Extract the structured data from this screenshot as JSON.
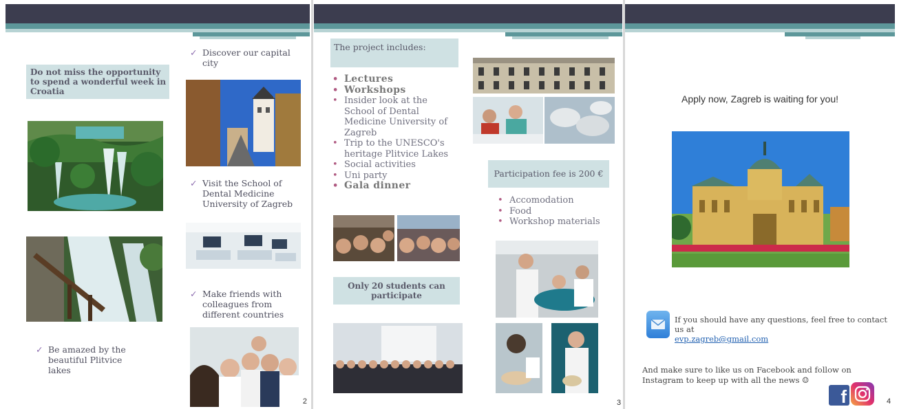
{
  "page2": {
    "opportunity_box": "Do not miss the opportunity to spend a wonderful  week in Croatia",
    "discover": "Discover our capital city",
    "visit": "Visit the School of Dental Medicine University of Zagreb",
    "friends": "Make friends with colleagues from different countries",
    "amazed": "Be amazed by the beautiful Plitvice lakes",
    "page_number": "2"
  },
  "page3": {
    "project_title": "The project includes:",
    "project_items": [
      {
        "text": "Lectures",
        "emphasis": true
      },
      {
        "text": "Workshops",
        "emphasis": true
      },
      {
        "text": "Insider look at the School of Dental Medicine University of Zagreb",
        "emphasis": false
      },
      {
        "text": "Trip to the  UNESCO's heritage Plitvice Lakes",
        "emphasis": false
      },
      {
        "text": "Social activities",
        "emphasis": false
      },
      {
        "text": "Uni party",
        "emphasis": false
      },
      {
        "text": "Gala dinner",
        "emphasis": true
      }
    ],
    "fee_box": "Participation fee is 200 €",
    "fee_items": [
      "Accomodation",
      "Food",
      "Workshop materials"
    ],
    "only_box": "Only 20 students can participate",
    "page_number": "3"
  },
  "page4": {
    "apply": "Apply now, Zagreb is waiting for you!",
    "contact_text": "If you should have any questions, feel free to contact us at",
    "contact_email": "evp.zagreb@gmail.com",
    "social_text": "And make sure to like us on Facebook and follow on Instagram to keep up with all the news ☺",
    "page_number": "4"
  },
  "colors": {
    "header_dark": "#3c3d4f",
    "header_teal": "#5d979a",
    "box": "#cfe1e3",
    "tick": "#8e6fb0",
    "bullet": "#b05a82"
  }
}
